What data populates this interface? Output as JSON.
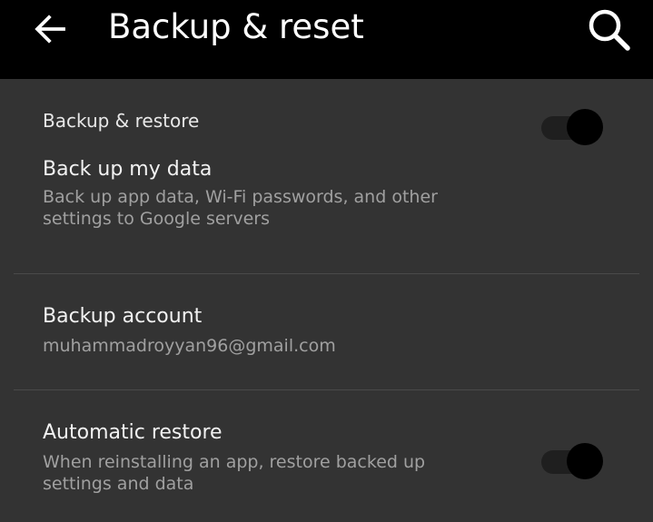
{
  "header": {
    "title": "Backup & reset",
    "back_icon": "arrow-left-icon",
    "search_icon": "search-icon"
  },
  "section": {
    "title": "Backup & restore"
  },
  "items": [
    {
      "title": "Back up my data",
      "summary": "Back up app data, Wi-Fi passwords, and other settings to Google servers",
      "toggle": true
    },
    {
      "title": "Backup account",
      "summary": "muhammadroyyan96@gmail.com"
    },
    {
      "title": "Automatic restore",
      "summary": "When reinstalling an app, restore backed up settings and data",
      "toggle": true
    }
  ],
  "colors": {
    "appbar": "#000000",
    "background": "#333333",
    "title_text": "#ffffff",
    "summary_text": "#a0a0a0",
    "divider": "#4a4a4a"
  }
}
